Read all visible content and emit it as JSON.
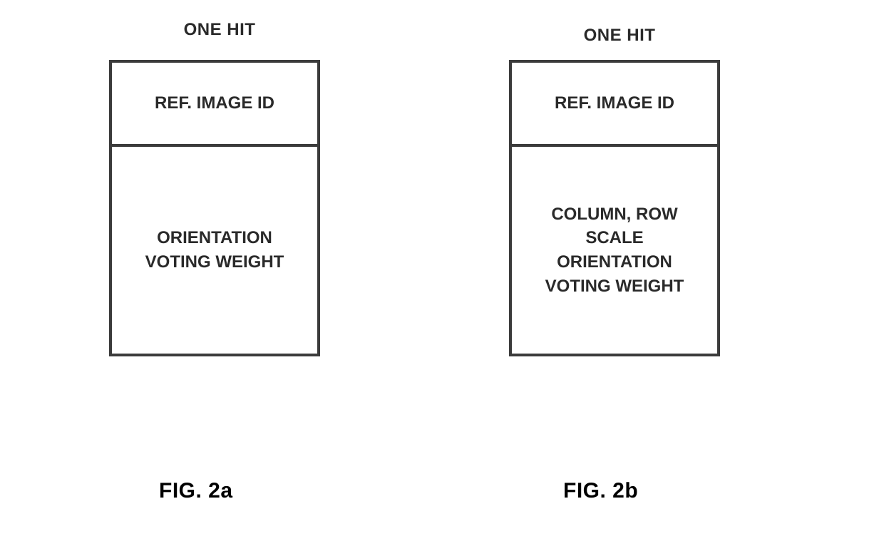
{
  "figures": {
    "a": {
      "title": "ONE HIT",
      "top": "REF. IMAGE ID",
      "bottom_line1": "ORIENTATION",
      "bottom_line2": "VOTING WEIGHT",
      "caption": "FIG. 2a"
    },
    "b": {
      "title": "ONE HIT",
      "top": "REF. IMAGE ID",
      "bottom_line1": "COLUMN, ROW",
      "bottom_line2": "SCALE",
      "bottom_line3": "ORIENTATION",
      "bottom_line4": "VOTING WEIGHT",
      "caption": "FIG. 2b"
    }
  }
}
